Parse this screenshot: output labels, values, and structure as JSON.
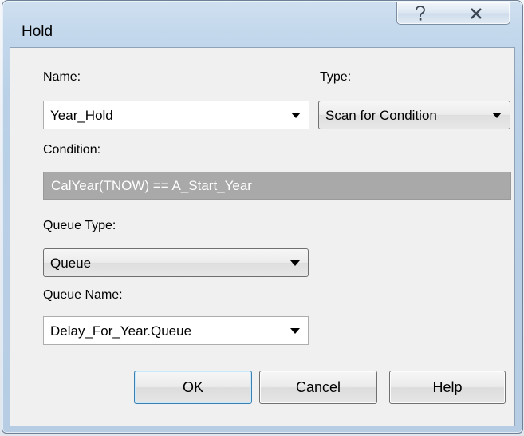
{
  "window": {
    "title": "Hold"
  },
  "titlebar": {
    "help_icon": "question-mark-icon",
    "close_icon": "close-x-icon"
  },
  "form": {
    "name_label": "Name:",
    "name_value": "Year_Hold",
    "type_label": "Type:",
    "type_value": "Scan for Condition",
    "condition_label": "Condition:",
    "condition_value": "CalYear(TNOW)  == A_Start_Year",
    "queue_type_label": "Queue Type:",
    "queue_type_value": "Queue",
    "queue_name_label": "Queue Name:",
    "queue_name_value": "Delay_For_Year.Queue"
  },
  "buttons": {
    "ok": "OK",
    "cancel": "Cancel",
    "help": "Help"
  }
}
